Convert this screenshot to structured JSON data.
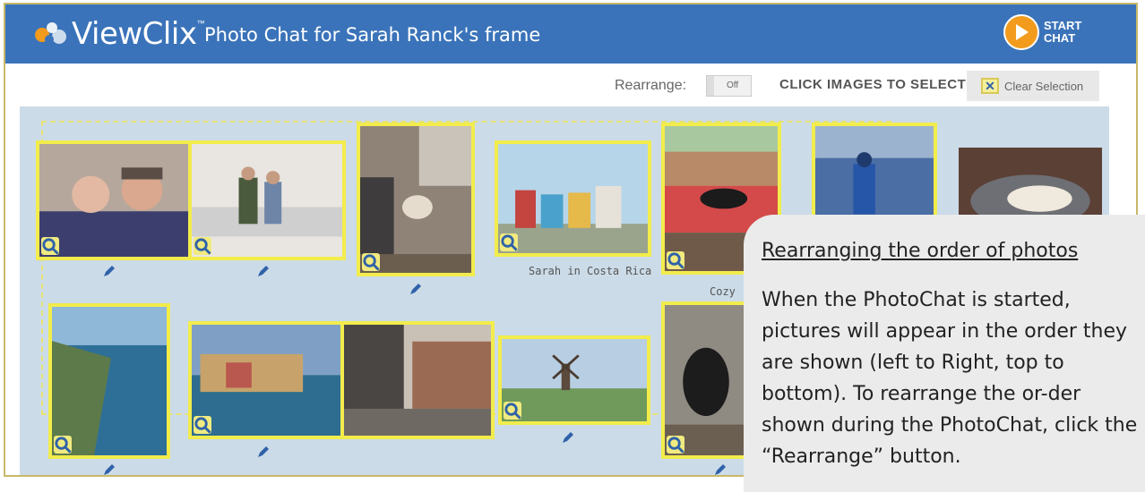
{
  "header": {
    "logo_text": "ViewClix",
    "logo_tm": "™",
    "title": "Photo Chat for Sarah Ranck's frame",
    "start_chat_line1": "START",
    "start_chat_line2": "CHAT"
  },
  "toolbar": {
    "rearrange_label": "Rearrange:",
    "toggle_state": "Off",
    "select_label": "CLICK IMAGES TO SELECT",
    "clear_selection_label": "Clear Selection"
  },
  "photos": [
    {
      "name": "couple-selfie",
      "caption": ""
    },
    {
      "name": "couple-on-couch",
      "caption": ""
    },
    {
      "name": "dog-on-floor",
      "caption": ""
    },
    {
      "name": "jaco-sign",
      "caption": "Sarah in Costa Rica"
    },
    {
      "name": "dog-on-patio",
      "caption": "Cozy"
    },
    {
      "name": "baseball-player",
      "caption": ""
    },
    {
      "name": "dog-in-bed",
      "caption": ""
    },
    {
      "name": "coastline",
      "caption": ""
    },
    {
      "name": "colorful-village",
      "caption": ""
    },
    {
      "name": "old-town-street",
      "caption": ""
    },
    {
      "name": "windmills",
      "caption": ""
    },
    {
      "name": "black-dog",
      "caption": ""
    }
  ],
  "info": {
    "title": "Rearranging the order of photos",
    "body": "When the PhotoChat is started, pictures will appear in the order they are shown (left to Right, top to bottom). To rearrange the or-der shown during the PhotoChat, click the “Rearrange” button."
  },
  "colors": {
    "header_bg": "#3a73b9",
    "accent_orange": "#f29b1d",
    "selection_yellow": "#f2ec4c",
    "board_bg": "#cbdbe8"
  }
}
